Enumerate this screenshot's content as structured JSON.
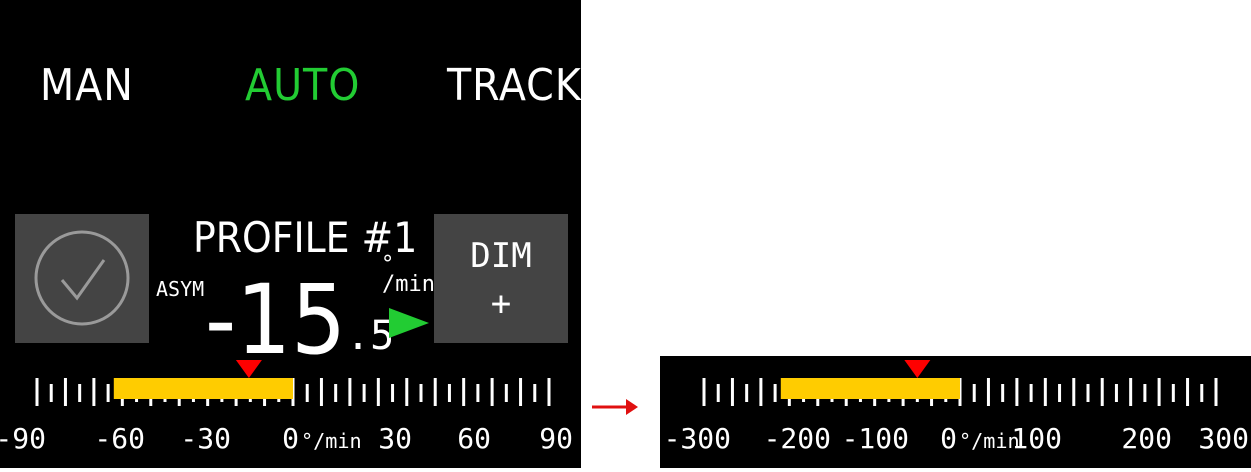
{
  "modes": {
    "man": "MAN",
    "auto": "AUTO",
    "track": "TRACK",
    "active_color": "#22cc33",
    "inactive_color": "#ffffff"
  },
  "profile": {
    "title": "PROFILE #1",
    "asym_label": "ASYM",
    "rate_integer": "-15",
    "rate_decimal": ".5",
    "unit_deg": "°",
    "unit_min": "/min",
    "direction_icon": "play-arrow-icon",
    "direction_color": "#22cc33"
  },
  "confirm_button": {
    "icon": "checkmark-circle-icon"
  },
  "dim_button": {
    "label": "DIM",
    "sub_label": "+"
  },
  "scale_main": {
    "ticks": [
      "-90",
      "-60",
      "-30",
      "0",
      "30",
      "60",
      "90"
    ],
    "zero_unit": "°/min",
    "range": [
      -90,
      90
    ],
    "bar_range": [
      -63,
      0
    ],
    "marker_value": -15.5,
    "bar_color": "#ffcc00",
    "marker_color": "#ff0000"
  },
  "arrow_icon": "right-arrow-icon",
  "scale_expanded": {
    "ticks": [
      "-300",
      "-200",
      "-100",
      "0",
      "100",
      "200",
      "300"
    ],
    "zero_unit": "°/min",
    "range": [
      -300,
      300
    ],
    "bar_range": [
      -210,
      0
    ],
    "marker_value": -50,
    "bar_color": "#ffcc00",
    "marker_color": "#ff0000"
  }
}
